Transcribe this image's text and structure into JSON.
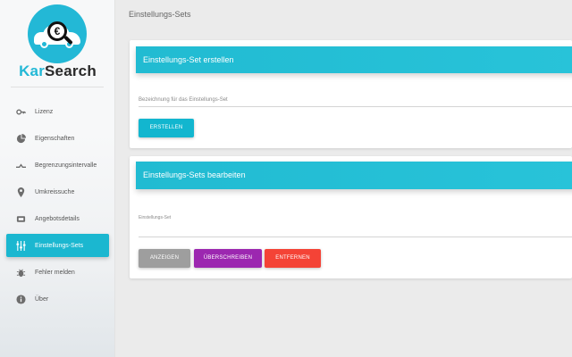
{
  "brand": {
    "name_part1": "Kar",
    "name_part2": "Search",
    "logo_symbol": "€",
    "accent": "#23b8d6"
  },
  "sidebar": {
    "items": [
      {
        "label": "Lizenz",
        "icon": "key-icon",
        "active": false
      },
      {
        "label": "Eigenschaften",
        "icon": "pie-chart-icon",
        "active": false
      },
      {
        "label": "Begrenzungsintervalle",
        "icon": "interval-icon",
        "active": false
      },
      {
        "label": "Umkreissuche",
        "icon": "location-pin-icon",
        "active": false
      },
      {
        "label": "Angebotsdetails",
        "icon": "ticket-icon",
        "active": false
      },
      {
        "label": "Einstellungs-Sets",
        "icon": "settings-sets-icon",
        "active": true
      },
      {
        "label": "Fehler melden",
        "icon": "bug-icon",
        "active": false
      },
      {
        "label": "Über",
        "icon": "info-icon",
        "active": false
      }
    ]
  },
  "main": {
    "page_title": "Einstellungs-Sets",
    "create_card": {
      "title": "Einstellungs-Set erstellen",
      "field_label": "Bezeichnung für das Einstellungs-Set",
      "button_label": "ERSTELLEN"
    },
    "edit_card": {
      "title": "Einstellungs-Sets bearbeiten",
      "field_label": "Einstellungs-Set",
      "buttons": {
        "show": "ANZEIGEN",
        "overwrite": "ÜBERSCHREIBEN",
        "remove": "ENTFERNEN"
      }
    }
  },
  "colors": {
    "active_nav": "#1bb7d0",
    "header": "#21bbd2",
    "show": "#9e9e9e",
    "overwrite": "#9c27b0",
    "remove": "#f44336"
  }
}
